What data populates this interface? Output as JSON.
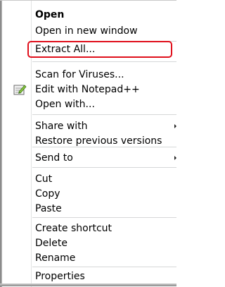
{
  "context_menu": {
    "groups": [
      {
        "items": [
          {
            "label": "Open",
            "bold": true
          },
          {
            "label": "Open in new window"
          }
        ]
      },
      {
        "items": [
          {
            "label": "Extract All...",
            "highlighted": true
          }
        ]
      },
      {
        "items": [
          {
            "label": "Scan for Viruses..."
          },
          {
            "label": "Edit with Notepad++",
            "icon": "notepad-plus-plus-icon"
          },
          {
            "label": "Open with..."
          }
        ]
      },
      {
        "items": [
          {
            "label": "Share with",
            "submenu": true
          },
          {
            "label": "Restore previous versions"
          }
        ]
      },
      {
        "items": [
          {
            "label": "Send to",
            "submenu": true
          }
        ]
      },
      {
        "items": [
          {
            "label": "Cut"
          },
          {
            "label": "Copy"
          },
          {
            "label": "Paste"
          }
        ]
      },
      {
        "items": [
          {
            "label": "Create shortcut"
          },
          {
            "label": "Delete"
          },
          {
            "label": "Rename"
          }
        ]
      },
      {
        "items": [
          {
            "label": "Properties"
          }
        ]
      }
    ]
  },
  "colors": {
    "highlight_outline": "#e0101c",
    "separator": "#d6d7d8",
    "text": "#000000"
  }
}
